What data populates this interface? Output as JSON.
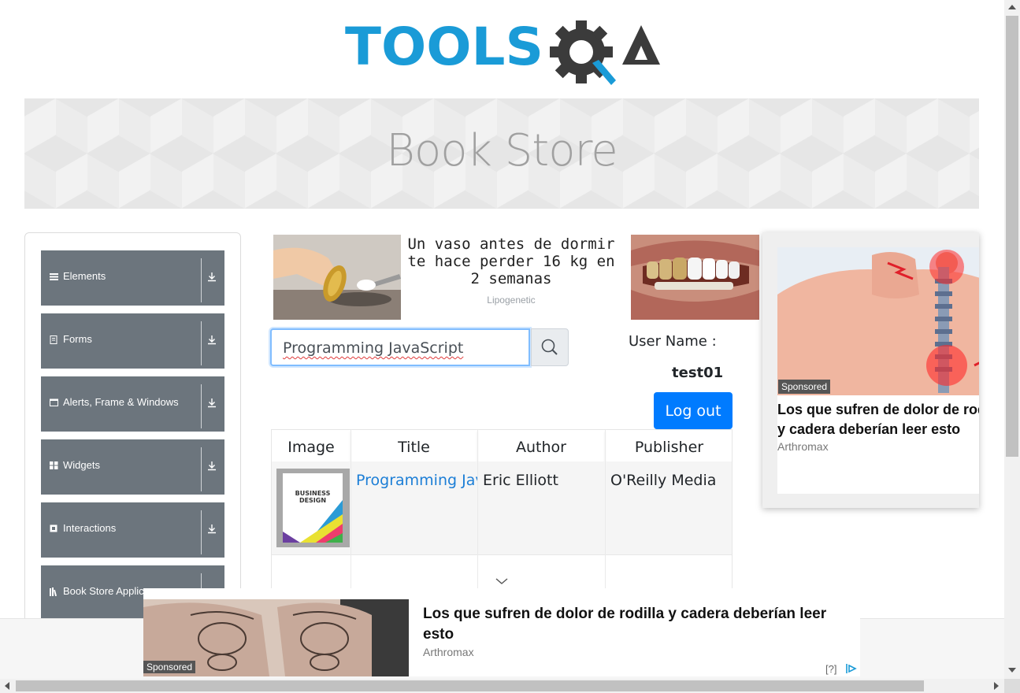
{
  "header": {
    "logo_text": "TOOLSQA",
    "page_title": "Book Store"
  },
  "sidebar": {
    "items": [
      {
        "label": "Elements",
        "icon": "list-icon"
      },
      {
        "label": "Forms",
        "icon": "form-icon"
      },
      {
        "label": "Alerts, Frame & Windows",
        "icon": "window-icon"
      },
      {
        "label": "Widgets",
        "icon": "grid-icon"
      },
      {
        "label": "Interactions",
        "icon": "interaction-icon"
      },
      {
        "label": "Book Store Applica",
        "icon": "books-icon"
      }
    ]
  },
  "ad_top": {
    "text": "Un vaso antes de dormir te hace perder 16 kg en 2 semanas",
    "brand": "Lipogenetic"
  },
  "search": {
    "value": "Programming JavaScript",
    "icon": "search-icon"
  },
  "user": {
    "label": "User Name :",
    "value": "test01",
    "logout_label": "Log out"
  },
  "table": {
    "headers": [
      "Image",
      "Title",
      "Author",
      "Publisher"
    ],
    "rows": [
      {
        "title": "Programming JavaScript Applications",
        "author": "Eric Elliott",
        "publisher": "O'Reilly Media",
        "cover_lines": [
          "BUSINESS",
          "DESIGN"
        ]
      }
    ]
  },
  "ad_right": {
    "sponsored": "Sponsored",
    "title": "Los que sufren de dolor de rodilla y cadera deberían leer esto",
    "brand": "Arthromax"
  },
  "ad_bottom": {
    "sponsored": "Sponsored",
    "title": "Los que sufren de dolor de rodilla y cadera deberían leer esto",
    "brand": "Arthromax",
    "help": "[?]"
  },
  "colors": {
    "accent": "#007bff",
    "sidebar_item": "#6c757d",
    "logo_blue": "#1a9bd7",
    "logo_dark": "#3b3b3b",
    "link": "#1c7ed6"
  }
}
